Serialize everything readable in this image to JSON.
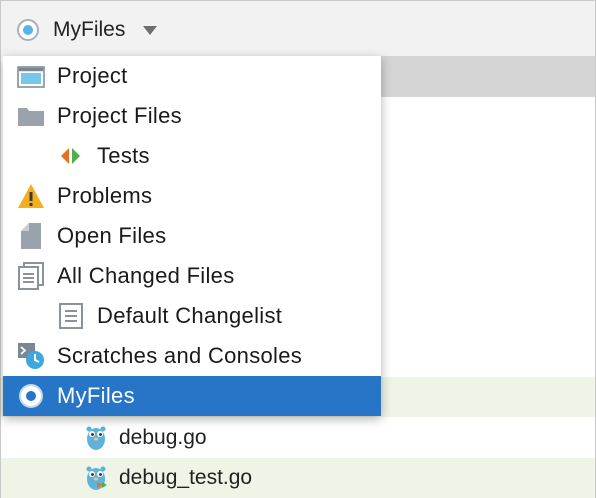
{
  "toolbar": {
    "selected_view": "MyFiles"
  },
  "menu": {
    "items": [
      {
        "label": "Project",
        "icon": "project-window-icon",
        "indent": false,
        "selected": false
      },
      {
        "label": "Project Files",
        "icon": "folder-icon",
        "indent": false,
        "selected": false
      },
      {
        "label": "Tests",
        "icon": "tests-icon",
        "indent": true,
        "selected": false
      },
      {
        "label": "Problems",
        "icon": "warning-icon",
        "indent": false,
        "selected": false
      },
      {
        "label": "Open Files",
        "icon": "file-icon",
        "indent": false,
        "selected": false
      },
      {
        "label": "All Changed Files",
        "icon": "changes-stack-icon",
        "indent": false,
        "selected": false
      },
      {
        "label": "Default Changelist",
        "icon": "changelist-icon",
        "indent": true,
        "selected": false
      },
      {
        "label": "Scratches and Consoles",
        "icon": "scratches-icon",
        "indent": false,
        "selected": false
      },
      {
        "label": "MyFiles",
        "icon": "radio-icon",
        "indent": false,
        "selected": true
      }
    ]
  },
  "tree": {
    "files": [
      {
        "name": "debug.go",
        "icon": "gopher-icon"
      },
      {
        "name": "debug_test.go",
        "icon": "gopher-test-icon"
      }
    ]
  },
  "colors": {
    "selection": "#2675c7",
    "row_highlight": "#eef5e6",
    "accent_blue": "#5ab4e6",
    "warning_yellow": "#f2b01e"
  }
}
